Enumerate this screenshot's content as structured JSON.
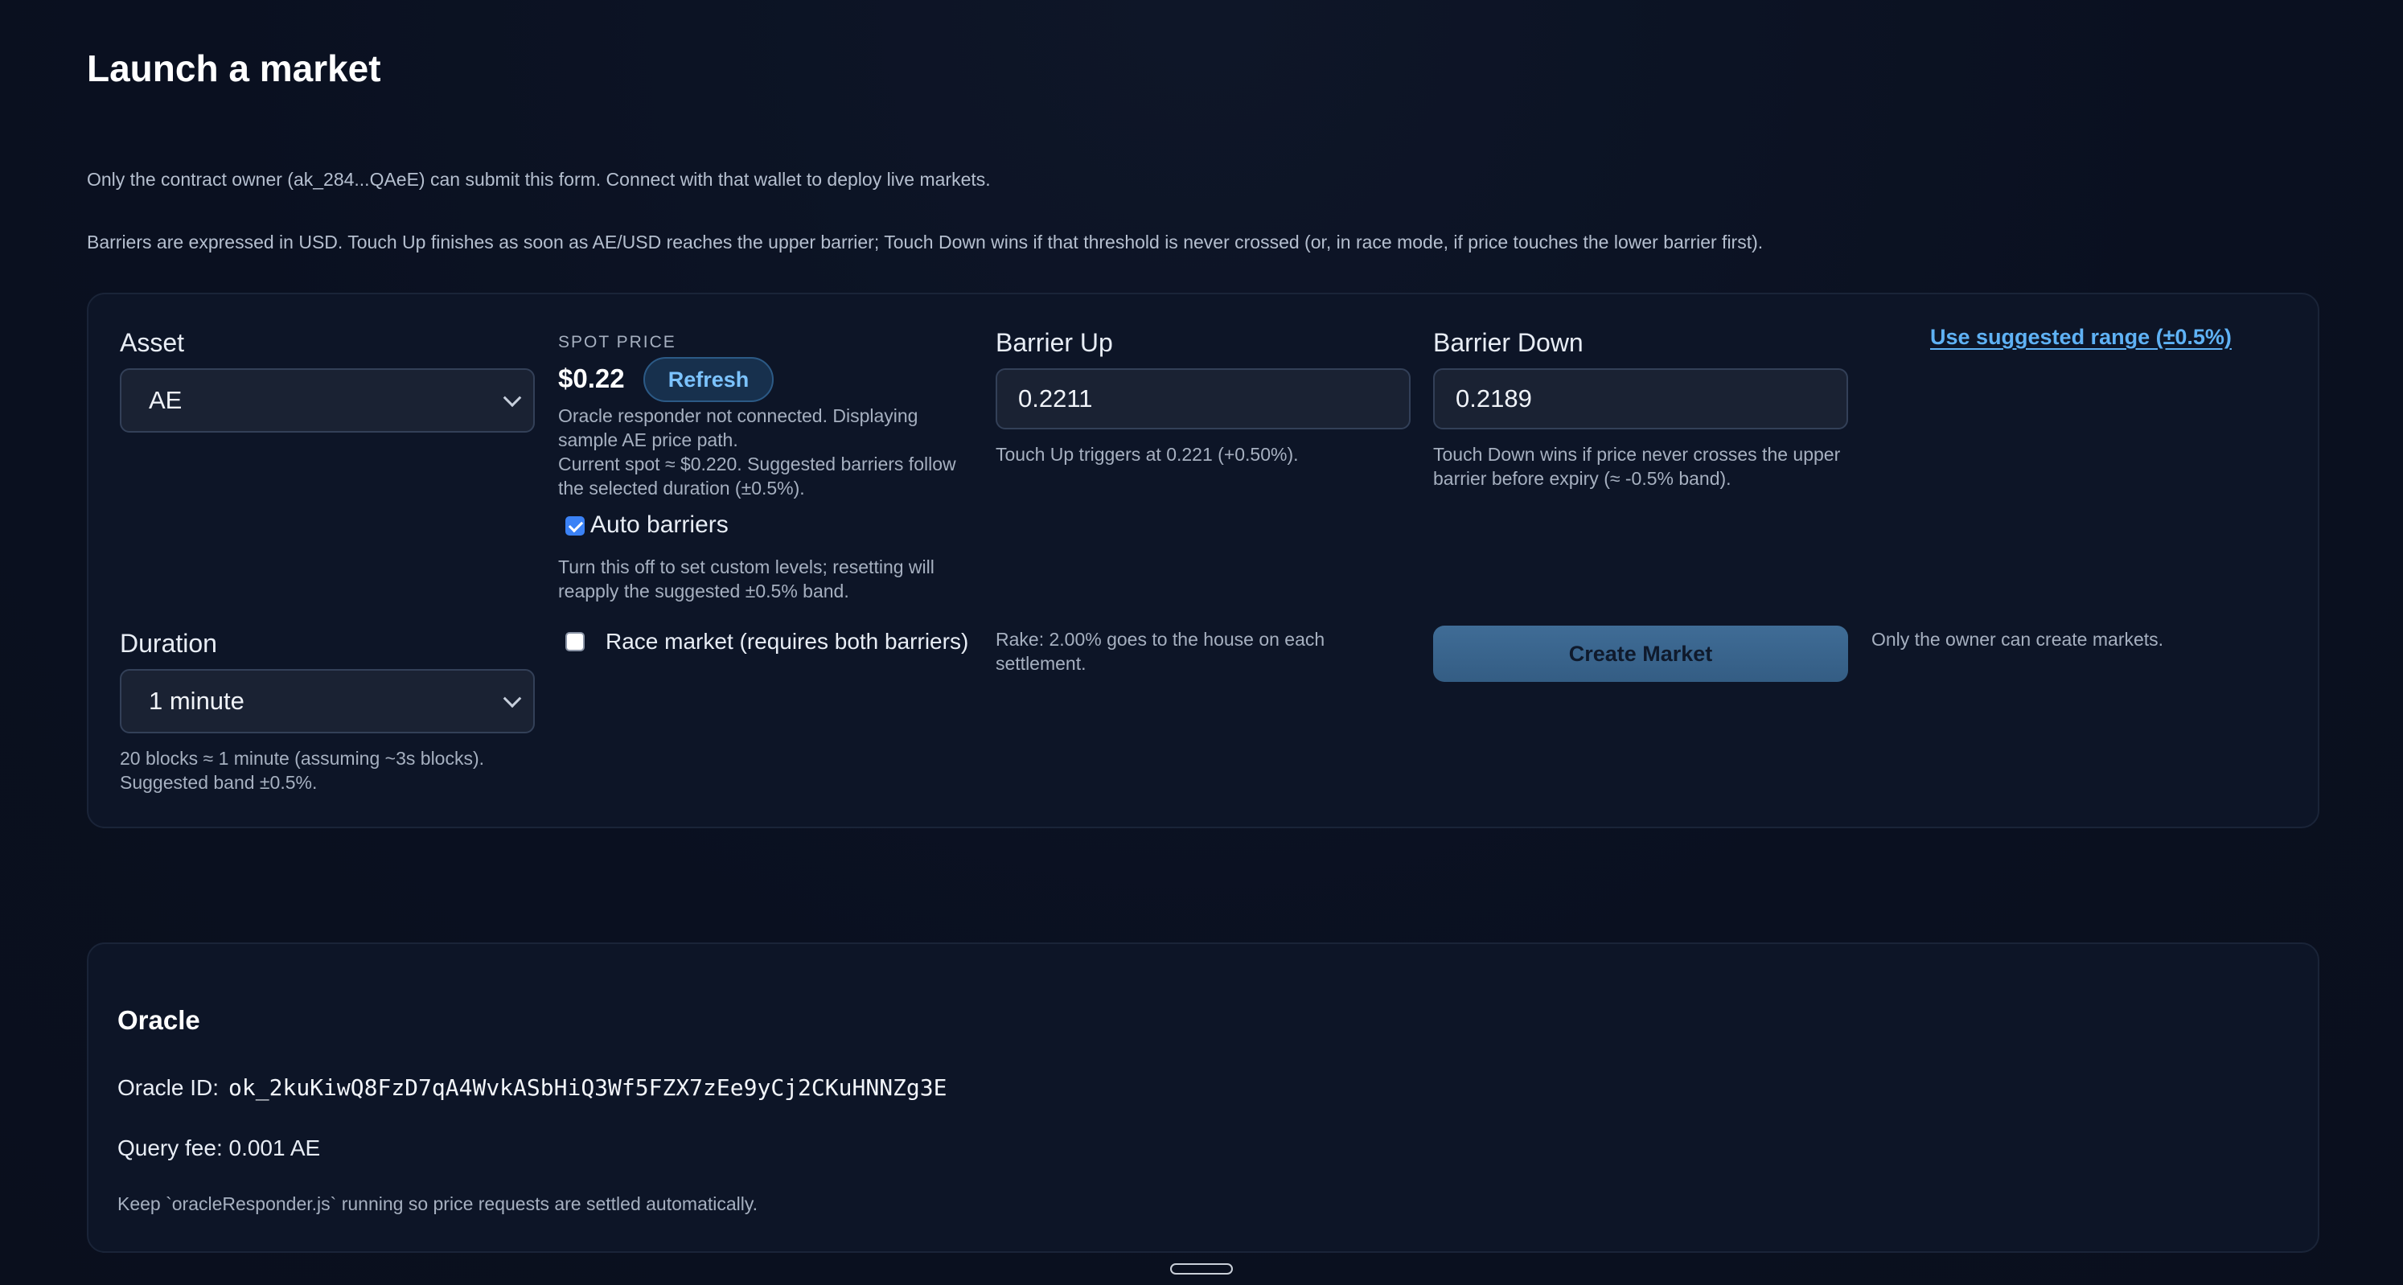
{
  "page": {
    "title": "Launch a market",
    "owner_note": "Only the contract owner (ak_284...QAeE) can submit this form. Connect with that wallet to deploy live markets.",
    "barrier_note": "Barriers are expressed in USD. Touch Up finishes as soon as AE/USD reaches the upper barrier; Touch Down wins if that threshold is never crossed (or, in race mode, if price touches the lower barrier first)."
  },
  "form": {
    "asset": {
      "label": "Asset",
      "value": "AE"
    },
    "spot": {
      "label": "SPOT PRICE",
      "value": "$0.22",
      "refresh_label": "Refresh",
      "status_line1": "Oracle responder not connected. Displaying",
      "status_line2": "sample AE price path.",
      "status_line3": "Current spot ≈ $0.220. Suggested barriers follow",
      "status_line4": "the selected duration (±0.5%)."
    },
    "auto_barriers": {
      "label": "Auto barriers",
      "checked": true,
      "help_line1": "Turn this off to set custom levels; resetting will",
      "help_line2": "reapply the suggested ±0.5% band."
    },
    "barrier_up": {
      "label": "Barrier Up",
      "value": "0.2211",
      "help": "Touch Up triggers at 0.221 (+0.50%)."
    },
    "barrier_down": {
      "label": "Barrier Down",
      "value": "0.2189",
      "help_line1": "Touch Down wins if price never crosses the upper",
      "help_line2": "barrier before expiry (≈ -0.5% band)."
    },
    "suggest_link": "Use suggested range (±0.5%)",
    "duration": {
      "label": "Duration",
      "value": "1 minute",
      "help_line1": "20 blocks ≈ 1 minute (assuming ~3s blocks).",
      "help_line2": "Suggested band ±0.5%."
    },
    "race": {
      "label": "Race market (requires both barriers)",
      "checked": false
    },
    "rake_line1": "Rake: 2.00% goes to the house on each",
    "rake_line2": "settlement.",
    "create_label": "Create Market",
    "owner_only": "Only the owner can create markets."
  },
  "oracle": {
    "title": "Oracle",
    "id_label": "Oracle ID:",
    "id_value": "ok_2kuKiwQ8FzD7qA4WvkASbHiQ3Wf5FZX7zEe9yCj2CKuHNNZg3E",
    "fee": "Query fee: 0.001 AE",
    "note": "Keep `oracleResponder.js` running so price requests are settled automatically."
  },
  "colors": {
    "accent": "#5fb2f5",
    "button": "#345d84",
    "background": "#0a1020",
    "card": "#0d1527"
  }
}
